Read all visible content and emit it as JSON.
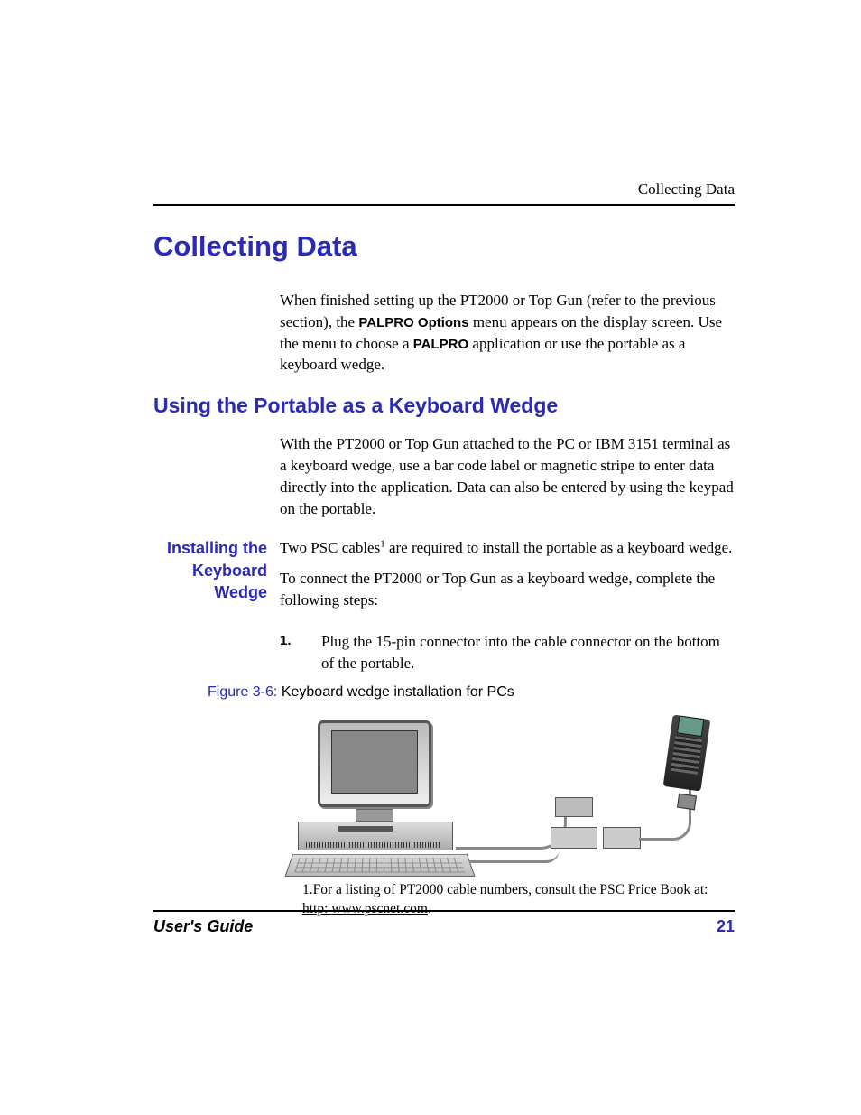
{
  "header": {
    "running_title": "Collecting Data"
  },
  "chapter": {
    "title": "Collecting Data"
  },
  "intro": {
    "part1": "When finished setting up the PT2000 or Top Gun (refer to the previous section), the ",
    "bold1": "PALPRO Options",
    "part2": " menu appears on the display screen. Use the menu to choose a ",
    "bold2": "PALPRO",
    "part3": " application or use the portable as a keyboard wedge."
  },
  "section1": {
    "title": "Using the Portable as a Keyboard Wedge",
    "body": "With the PT2000 or Top Gun attached to the PC or IBM 3151 terminal as a keyboard wedge, use a bar code label or magnetic stripe to enter data directly into the application. Data can also be entered by using the keypad on the portable."
  },
  "subsection": {
    "label": "Installing the Keyboard Wedge",
    "p1_a": "Two PSC cables",
    "p1_sup": "1",
    "p1_b": " are required to install the portable as a keyboard wedge.",
    "p2": "To connect the PT2000 or Top Gun as a keyboard wedge, complete the following steps:"
  },
  "steps": {
    "num1": "1.",
    "text1": "Plug the 15-pin connector into the cable connector on the bottom of the portable."
  },
  "figure": {
    "label": "Figure 3-6:",
    "caption": "Keyboard wedge installation for PCs"
  },
  "footnote": {
    "lead": "1.For a listing of PT2000 cable numbers, consult the PSC Price Book at: ",
    "link_text": "http: www.pscnet.com",
    "trail": "."
  },
  "footer": {
    "left": "User's Guide",
    "right": "21"
  }
}
